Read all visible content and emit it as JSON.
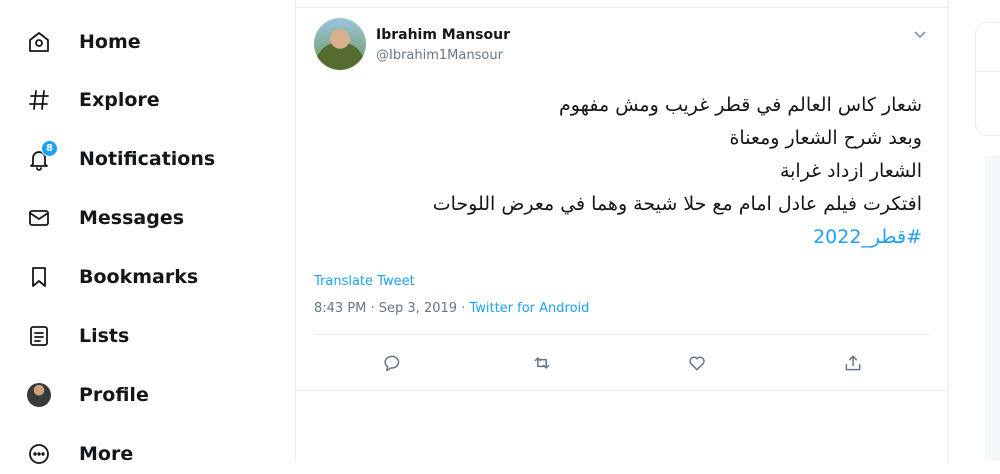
{
  "nav": {
    "items": [
      {
        "label": "Home",
        "icon": "home-icon"
      },
      {
        "label": "Explore",
        "icon": "hashtag-icon"
      },
      {
        "label": "Notifications",
        "icon": "bell-icon",
        "badge": "8"
      },
      {
        "label": "Messages",
        "icon": "envelope-icon"
      },
      {
        "label": "Bookmarks",
        "icon": "bookmark-icon"
      },
      {
        "label": "Lists",
        "icon": "list-icon"
      },
      {
        "label": "Profile",
        "icon": "avatar"
      },
      {
        "label": "More",
        "icon": "more-icon"
      }
    ]
  },
  "tweet": {
    "name": "Ibrahim Mansour",
    "handle": "@Ibrahim1Mansour",
    "lines": [
      "شعار كاس العالم في قطر غريب ومش مفهوم",
      "وبعد شرح الشعار ومعناة",
      "الشعار ازداد غرابة",
      "افتكرت فيلم عادل امام مع حلا شيحة وهما في معرض اللوحات"
    ],
    "hashtag": "#قطر_2022",
    "translate": "Translate Tweet",
    "timestamp": "8:43 PM · Sep 3, 2019 · ",
    "source": "Twitter for Android"
  },
  "colors": {
    "accent": "#1da1f2",
    "text": "#14171a",
    "muted": "#657786",
    "border": "#e6ecf0"
  }
}
